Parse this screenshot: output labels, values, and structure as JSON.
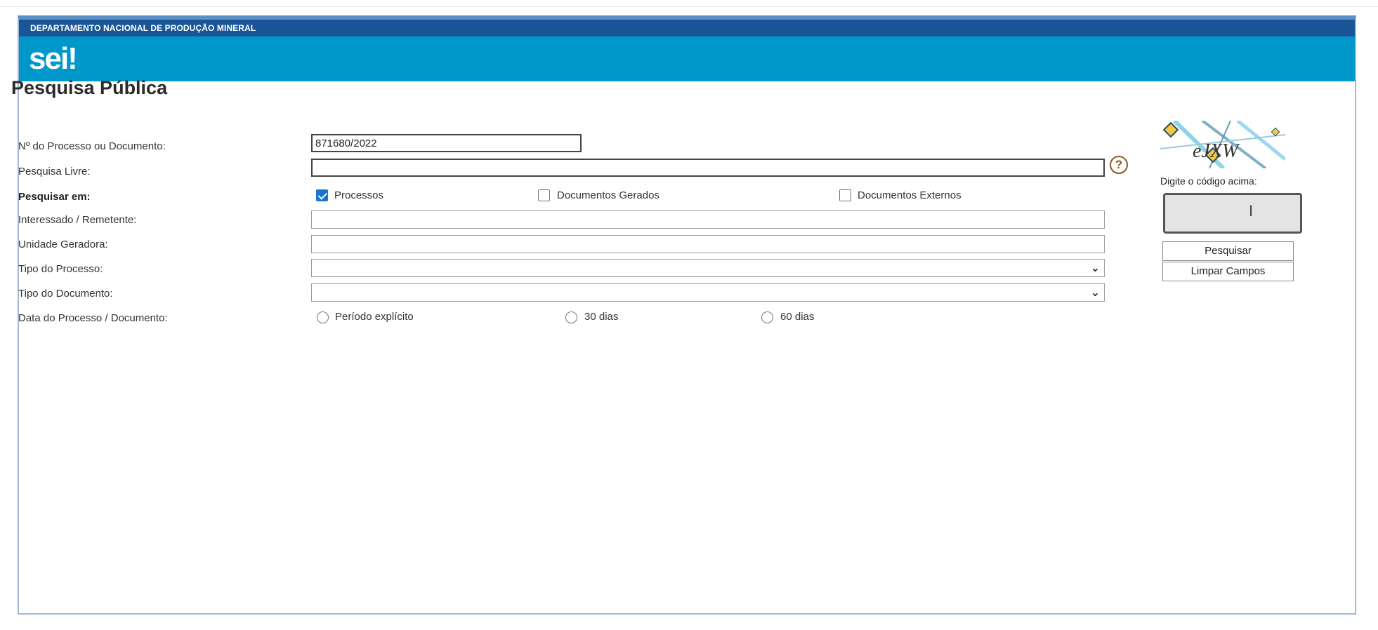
{
  "header": {
    "org_name": "DEPARTAMENTO NACIONAL DE PRODUÇÃO MINERAL",
    "logo_text": "sei!"
  },
  "page": {
    "title": "Pesquisa Pública"
  },
  "form": {
    "process_number": {
      "label": "Nº do Processo ou Documento:",
      "value": "871680/2022"
    },
    "free_search": {
      "label": "Pesquisa Livre:",
      "value": ""
    },
    "search_in": {
      "label": "Pesquisar em:",
      "options": [
        {
          "label": "Processos",
          "checked": true
        },
        {
          "label": "Documentos Gerados",
          "checked": false
        },
        {
          "label": "Documentos Externos",
          "checked": false
        }
      ]
    },
    "interested": {
      "label": "Interessado / Remetente:",
      "value": ""
    },
    "unit": {
      "label": "Unidade Geradora:",
      "value": ""
    },
    "process_type": {
      "label": "Tipo do Processo:",
      "value": ""
    },
    "document_type": {
      "label": "Tipo do Documento:",
      "value": ""
    },
    "date": {
      "label": "Data do Processo / Documento:",
      "options": [
        {
          "label": "Período explícito",
          "selected": false
        },
        {
          "label": "30 dias",
          "selected": false
        },
        {
          "label": "60 dias",
          "selected": false
        }
      ]
    }
  },
  "captcha": {
    "text": "eJXW",
    "prompt": "Digite o código acima:",
    "value": ""
  },
  "buttons": {
    "search": "Pesquisar",
    "clear": "Limpar Campos"
  },
  "icons": {
    "help": "help-circle-icon",
    "dropdown": "chevron-down-icon",
    "cursor": "text-cursor-icon"
  },
  "colors": {
    "org_bar": "#1a5597",
    "brand_bar": "#0098cb",
    "checkbox_checked": "#1a73d6",
    "help_icon": "#8a5a1f"
  }
}
